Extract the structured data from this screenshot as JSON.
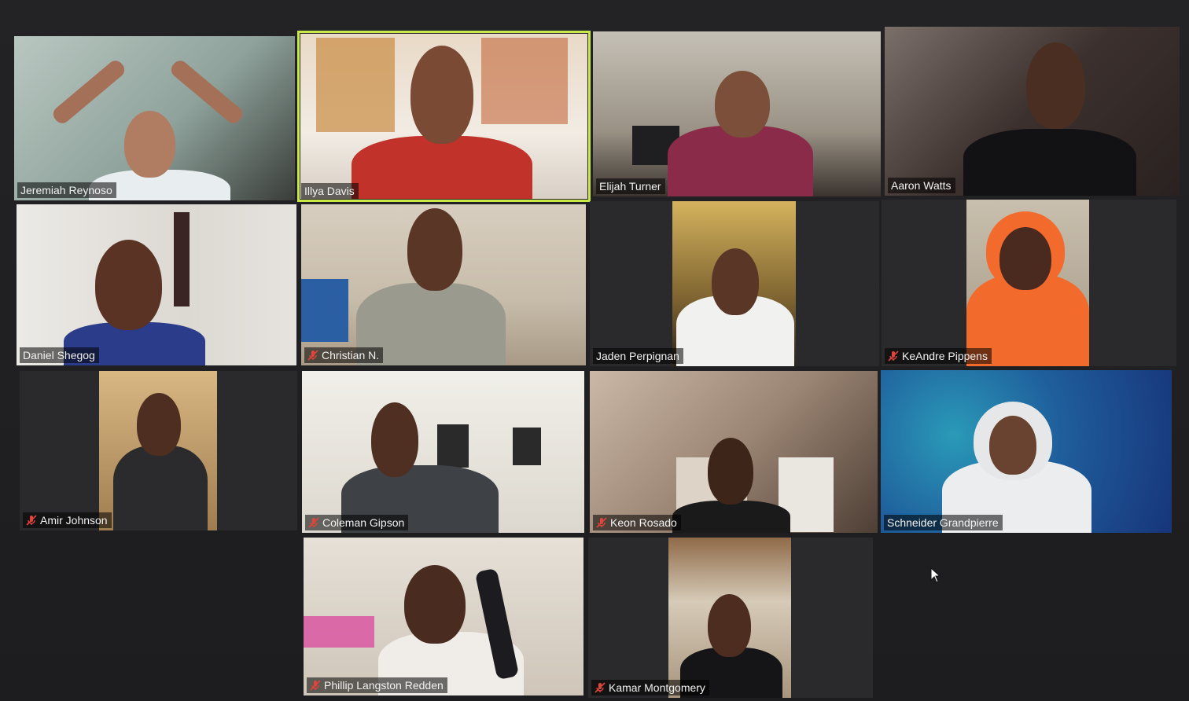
{
  "participants": [
    {
      "name": "Jeremiah Reynoso",
      "muted": false,
      "active_speaker": false
    },
    {
      "name": "Illya Davis",
      "muted": false,
      "active_speaker": true
    },
    {
      "name": "Elijah Turner",
      "muted": false,
      "active_speaker": false
    },
    {
      "name": "Aaron Watts",
      "muted": false,
      "active_speaker": false
    },
    {
      "name": "Daniel Shegog",
      "muted": false,
      "active_speaker": false
    },
    {
      "name": "Christian N.",
      "muted": true,
      "active_speaker": false
    },
    {
      "name": "Jaden Perpignan",
      "muted": false,
      "active_speaker": false
    },
    {
      "name": "KeAndre Pippens",
      "muted": true,
      "active_speaker": false
    },
    {
      "name": "Amir Johnson",
      "muted": true,
      "active_speaker": false
    },
    {
      "name": "Coleman Gipson",
      "muted": true,
      "active_speaker": false
    },
    {
      "name": "Keon Rosado",
      "muted": true,
      "active_speaker": false
    },
    {
      "name": "Schneider Grandpierre",
      "muted": false,
      "active_speaker": false
    },
    {
      "name": "Phillip Langston Redden",
      "muted": true,
      "active_speaker": false
    },
    {
      "name": "Kamar Montgomery",
      "muted": true,
      "active_speaker": false
    }
  ],
  "colors": {
    "active_speaker_border": "#c9e84a",
    "muted_icon": "#e0443a",
    "name_text": "#f2f2f2"
  },
  "icons": {
    "muted": "mic-off-icon",
    "cursor": "mouse-pointer-icon"
  }
}
